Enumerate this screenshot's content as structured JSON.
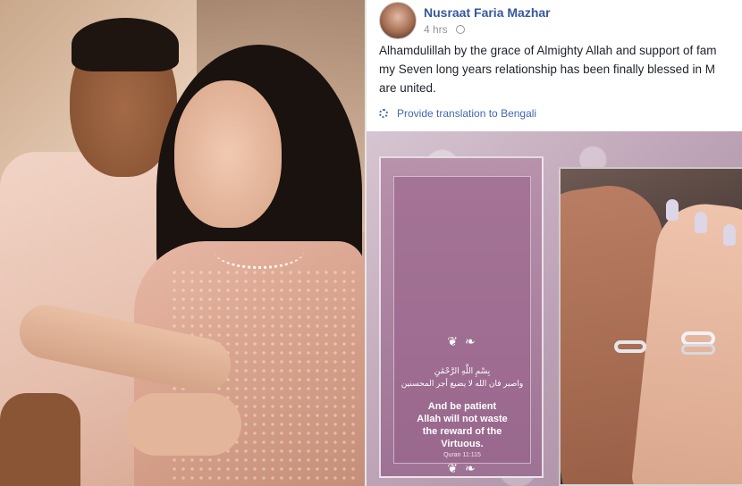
{
  "post": {
    "author": "Nusraat Faria Mazhar",
    "time": "4 hrs",
    "privacy_icon": "globe-icon",
    "text_lines": [
      "Alhamdulillah by the grace of Almighty Allah and support of fam",
      "my Seven long years relationship has been finally blessed in M",
      "are united."
    ],
    "translate_label": "Provide translation to Bengali",
    "translate_icon": "gear-icon"
  },
  "verse_card": {
    "ornament_top": "❦ ❧",
    "arabic_line_1": "بِسْمِ اللَّهِ الرَّحْمَٰنِ",
    "arabic_line_2": "واصبر فان الله لا يضيع أجر المحسنين",
    "english_lines": [
      "And be patient",
      "Allah will not waste",
      "the reward of the",
      "Virtuous."
    ],
    "reference": "Quran 11:115",
    "ornament_bottom": "❦ ❧"
  },
  "colors": {
    "link_blue": "#365899",
    "translate_blue": "#4267b2",
    "text": "#1d2129",
    "muted": "#90949c",
    "card_mauve": "#9e7294"
  }
}
